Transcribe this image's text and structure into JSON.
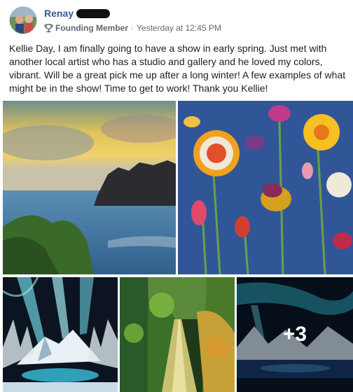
{
  "post": {
    "author": {
      "name": "Renay"
    },
    "badge": {
      "icon": "trophy-icon",
      "label": "Founding Member"
    },
    "separator": "·",
    "timestamp": "Yesterday at 12:45 PM",
    "text": "Kellie Day, I am finally going to have a show in early spring. Just met with another local artist who has a studio and gallery and he loved my colors, vibrant. Will be a great pick me up after a long winter! A few examples of what might be in the show! Time to get to work! Thank you Kellie!",
    "photos": [
      {
        "subject": "seascape-painting"
      },
      {
        "subject": "flowers-painting"
      },
      {
        "subject": "aurora-mountain-painting"
      },
      {
        "subject": "forest-path-painting"
      },
      {
        "subject": "aurora-lake-painting"
      }
    ],
    "more_photos": "+3"
  }
}
